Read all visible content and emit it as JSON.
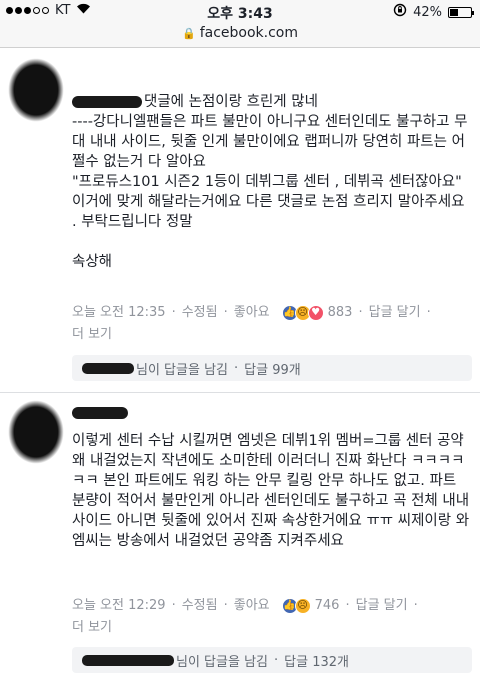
{
  "status_bar": {
    "carrier": "KT",
    "time": "오후 3:43",
    "battery_percent": "42%",
    "battery_level": 0.42
  },
  "url_bar": {
    "url": "facebook.com",
    "lock_icon": "lock-icon"
  },
  "comments": [
    {
      "text": "댓글에 논점이랑 흐린게 많네\n----강다니엘팬들은 파트 불만이 아니구요 센터인데도 불구하고 무대 내내 사이드, 뒷줄 인게 불만이에요 랩퍼니까 당연히 파트는 어쩔수 없는거 다 알아요\n\"프로듀스101 시즌2 1등이 데뷔그룹 센터 , 데뷔곡 센터잖아요\" 이거에 맞게 해달라는거에요 다른 댓글로 논점 흐리지 말아주세요 . 부탁드립니다 정말\n\n속상해",
      "time": "오늘 오전 12:35",
      "edited": "수정됨",
      "like": "좋아요",
      "reaction_count": "883",
      "reply": "답글 달기",
      "more": "더 보기",
      "reply_summary": "님이 답글을 남김",
      "reply_count": "답글 99개"
    },
    {
      "text": "이렇게 센터 수납 시킬꺼면 엠넷은 데뷔1위 멤버=그룹 센터 공약 왜 내걸었는지 작년에도 소미한테 이러더니 진짜 화난다 ㅋㅋㅋㅋㅋㅋ 본인 파트에도 워킹 하는 안무 킬링 안무 하나도 없고. 파트 분량이 적어서 불만인게 아니라 센터인데도 불구하고 곡 전체 내내 사이드 아니면 뒷줄에 있어서 진짜 속상한거에요 ㅠㅠ 씨제이랑 와엠씨는 방송에서 내걸었던 공약좀 지켜주세요",
      "time": "오늘 오전 12:29",
      "edited": "수정됨",
      "like": "좋아요",
      "reaction_count": "746",
      "reply": "답글 달기",
      "more": "더 보기",
      "reply_summary": "님이 답글을 남김",
      "reply_count": "답글 132개"
    }
  ],
  "colors": {
    "text": "#1d2129",
    "meta": "#90949c",
    "like_blue": "#4267b2",
    "reply_bg": "#f2f3f5"
  }
}
